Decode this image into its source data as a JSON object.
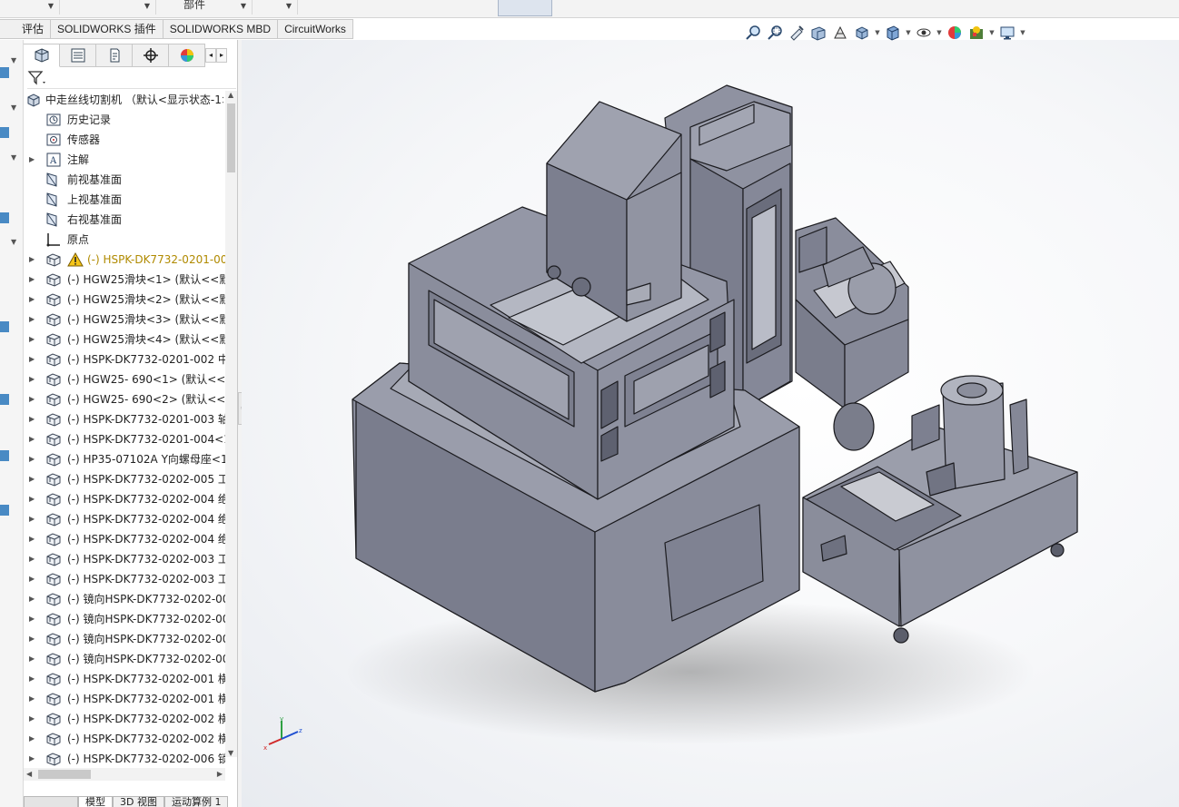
{
  "top_bar": {
    "partial_label": "部件"
  },
  "command_tabs": [
    "评估",
    "SOLIDWORKS 插件",
    "SOLIDWORKS MBD",
    "CircuitWorks"
  ],
  "hud_icons": [
    "zoom-to-fit-icon",
    "zoom-to-area-icon",
    "previous-view-icon",
    "section-view-icon",
    "dynamic-annotation-icon",
    "view-orientation-icon",
    "display-style-icon",
    "hide-show-icon",
    "edit-appearance-icon",
    "apply-scene-icon",
    "view-settings-icon"
  ],
  "feature_tree": {
    "root": "中走丝线切割机 （默认<显示状态-1>",
    "items": [
      {
        "label": "历史记录",
        "icon": "history-icon",
        "expandable": false
      },
      {
        "label": "传感器",
        "icon": "sensor-icon",
        "expandable": false
      },
      {
        "label": "注解",
        "icon": "annotation-icon",
        "expandable": true
      },
      {
        "label": "前视基准面",
        "icon": "plane-icon",
        "expandable": false
      },
      {
        "label": "上视基准面",
        "icon": "plane-icon",
        "expandable": false
      },
      {
        "label": "右视基准面",
        "icon": "plane-icon",
        "expandable": false
      },
      {
        "label": "原点",
        "icon": "origin-icon",
        "expandable": false
      },
      {
        "label": "(-) HSPK-DK7732-0201-00",
        "icon": "part-icon",
        "warning": true,
        "expandable": true
      },
      {
        "label": "(-) HGW25滑块<1> (默认<<默",
        "icon": "part-icon",
        "expandable": true
      },
      {
        "label": "(-) HGW25滑块<2> (默认<<默",
        "icon": "part-icon",
        "expandable": true
      },
      {
        "label": "(-) HGW25滑块<3> (默认<<默",
        "icon": "part-icon",
        "expandable": true
      },
      {
        "label": "(-) HGW25滑块<4> (默认<<默",
        "icon": "part-icon",
        "expandable": true
      },
      {
        "label": "(-) HSPK-DK7732-0201-002 中",
        "icon": "part-icon",
        "expandable": true
      },
      {
        "label": "(-) HGW25- 690<1> (默认<<默",
        "icon": "part-icon",
        "expandable": true
      },
      {
        "label": "(-) HGW25- 690<2> (默认<<默",
        "icon": "part-icon",
        "expandable": true
      },
      {
        "label": "(-) HSPK-DK7732-0201-003 轴",
        "icon": "part-icon",
        "expandable": true
      },
      {
        "label": "(-) HSPK-DK7732-0201-004<1",
        "icon": "part-icon",
        "expandable": true
      },
      {
        "label": "(-) HP35-07102A Y向螺母座<1:",
        "icon": "part-icon",
        "expandable": true
      },
      {
        "label": "(-) HSPK-DK7732-0202-005 工",
        "icon": "part-icon",
        "expandable": true
      },
      {
        "label": "(-) HSPK-DK7732-0202-004 绝",
        "icon": "part-icon",
        "expandable": true
      },
      {
        "label": "(-) HSPK-DK7732-0202-004 绝",
        "icon": "part-icon",
        "expandable": true
      },
      {
        "label": "(-) HSPK-DK7732-0202-004 绝",
        "icon": "part-icon",
        "expandable": true
      },
      {
        "label": "(-) HSPK-DK7732-0202-003 工",
        "icon": "part-icon",
        "expandable": true
      },
      {
        "label": "(-) HSPK-DK7732-0202-003 工",
        "icon": "part-icon",
        "expandable": true
      },
      {
        "label": "(-) 镜向HSPK-DK7732-0202-00",
        "icon": "part-icon",
        "expandable": true
      },
      {
        "label": "(-) 镜向HSPK-DK7732-0202-00",
        "icon": "part-icon",
        "expandable": true
      },
      {
        "label": "(-) 镜向HSPK-DK7732-0202-00",
        "icon": "part-icon",
        "expandable": true
      },
      {
        "label": "(-) 镜向HSPK-DK7732-0202-00",
        "icon": "part-icon",
        "expandable": true
      },
      {
        "label": "(-) HSPK-DK7732-0202-001 横",
        "icon": "part-icon",
        "expandable": true
      },
      {
        "label": "(-) HSPK-DK7732-0202-001 横",
        "icon": "part-icon",
        "expandable": true
      },
      {
        "label": "(-) HSPK-DK7732-0202-002 横",
        "icon": "part-icon",
        "expandable": true
      },
      {
        "label": "(-) HSPK-DK7732-0202-002 横",
        "icon": "part-icon",
        "expandable": true
      },
      {
        "label": "(-) HSPK-DK7732-0202-006 锁",
        "icon": "part-icon",
        "expandable": true
      }
    ]
  },
  "bottom_tabs": [
    "模型",
    "3D 视图",
    "运动算例 1"
  ],
  "triad": {
    "x": "x",
    "y": "y",
    "z": "z"
  },
  "colors": {
    "model_body": "#8c8f9e",
    "model_dark": "#6f7282",
    "warning": "#b08a00"
  }
}
